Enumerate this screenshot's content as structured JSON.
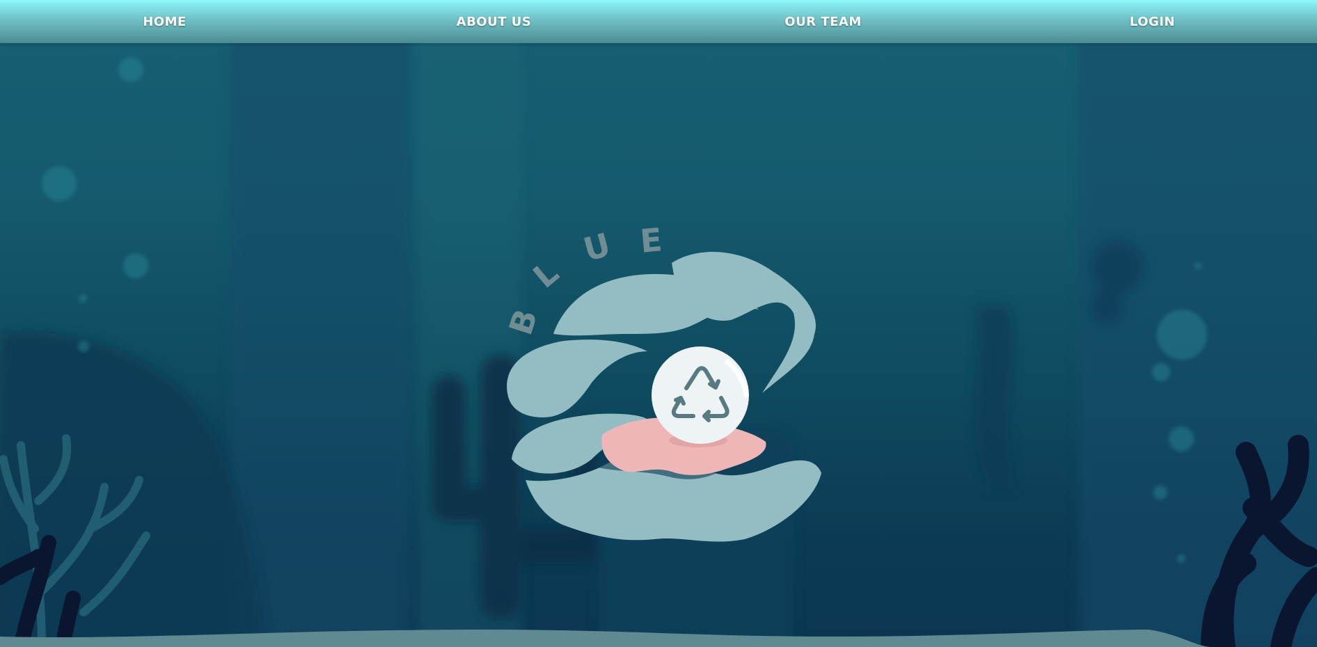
{
  "nav": {
    "items": [
      {
        "label": "HOME"
      },
      {
        "label": "ABOUT US"
      },
      {
        "label": "OUR TEAM"
      },
      {
        "label": "LOGIN"
      }
    ]
  },
  "hero": {
    "logo_text": "BLUE",
    "letters": [
      "B",
      "L",
      "U",
      "E"
    ],
    "icon": "recycle-icon"
  },
  "colors": {
    "nav_top": "#8ef8fb",
    "nav_bottom": "#4c8b91",
    "ocean": "#175f73",
    "ocean_deep": "#0b3650",
    "shell": "#93bcc3",
    "pearl": "#eef4f6",
    "tongue": "#efb6b8",
    "sand": "#5f8a92",
    "coral_dark": "#0a1530"
  }
}
